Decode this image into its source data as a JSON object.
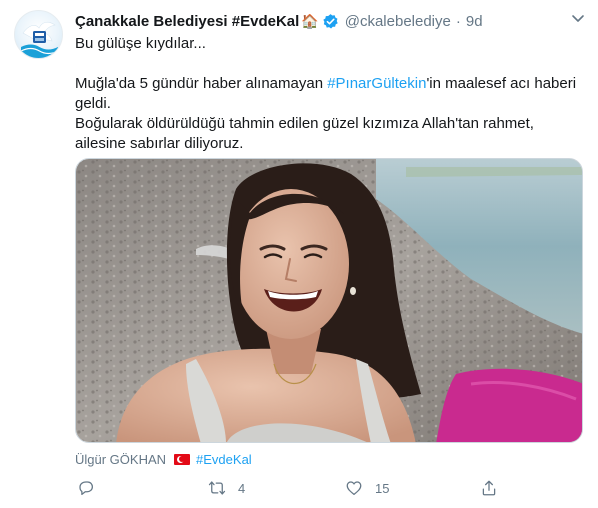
{
  "tweet": {
    "display_name": "Çanakkale Belediyesi #EvdeKal",
    "name_emoji": "🏠",
    "handle": "@ckalebelediye",
    "separator": "·",
    "time": "9d",
    "text_line1": "Bu gülüşe kıydılar...",
    "para2_before": "Muğla'da 5 gündür haber alınamayan ",
    "para2_hashtag": "#PınarGültekin",
    "para2_after": "'in maalesef acı haberi geldi.",
    "para3": "Boğularak öldürüldüğü tahmin edilen güzel kızımıza Allah'tan rahmet, ailesine sabırlar diliyoruz.",
    "tagged_user": "Ülgür GÖKHAN",
    "tagged_hashtag": "#EvdeKal",
    "retweet_count": "4",
    "like_count": "15"
  },
  "icons": {
    "verified": "verified-badge-icon",
    "caret": "chevron-down-icon",
    "reply": "reply-icon",
    "retweet": "retweet-icon",
    "like": "heart-icon",
    "share": "share-icon",
    "flag": "turkey-flag-icon"
  },
  "colors": {
    "link": "#1da1f2",
    "secondary_text": "#657786",
    "primary_text": "#14171a",
    "verified": "#1da1f2",
    "flag_red": "#e30a17"
  }
}
